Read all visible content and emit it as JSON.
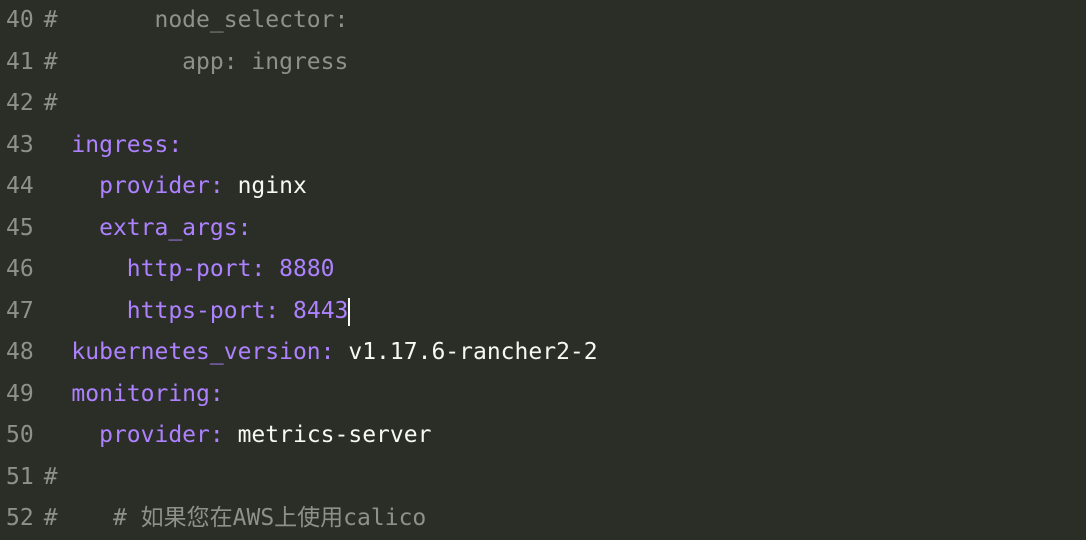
{
  "lines": [
    {
      "num": "40",
      "tokens": [
        {
          "text": "#       node_selector:",
          "cls": "comment"
        }
      ]
    },
    {
      "num": "41",
      "tokens": [
        {
          "text": "#         app: ingress",
          "cls": "comment"
        }
      ]
    },
    {
      "num": "42",
      "tokens": [
        {
          "text": "#",
          "cls": "comment"
        }
      ]
    },
    {
      "num": "43",
      "tokens": [
        {
          "text": "  ",
          "cls": ""
        },
        {
          "text": "ingress",
          "cls": "key"
        },
        {
          "text": ":",
          "cls": "colon"
        }
      ]
    },
    {
      "num": "44",
      "tokens": [
        {
          "text": "    ",
          "cls": ""
        },
        {
          "text": "provider",
          "cls": "key"
        },
        {
          "text": ":",
          "cls": "colon"
        },
        {
          "text": " nginx",
          "cls": "string"
        }
      ]
    },
    {
      "num": "45",
      "tokens": [
        {
          "text": "    ",
          "cls": ""
        },
        {
          "text": "extra_args",
          "cls": "key"
        },
        {
          "text": ":",
          "cls": "colon"
        }
      ]
    },
    {
      "num": "46",
      "tokens": [
        {
          "text": "      ",
          "cls": ""
        },
        {
          "text": "http-port",
          "cls": "key"
        },
        {
          "text": ":",
          "cls": "colon"
        },
        {
          "text": " ",
          "cls": ""
        },
        {
          "text": "8880",
          "cls": "number"
        }
      ]
    },
    {
      "num": "47",
      "tokens": [
        {
          "text": "      ",
          "cls": ""
        },
        {
          "text": "https-port",
          "cls": "key"
        },
        {
          "text": ":",
          "cls": "colon"
        },
        {
          "text": " ",
          "cls": ""
        },
        {
          "text": "8443",
          "cls": "number"
        }
      ],
      "cursorAfter": true
    },
    {
      "num": "48",
      "tokens": [
        {
          "text": "  ",
          "cls": ""
        },
        {
          "text": "kubernetes_version",
          "cls": "key"
        },
        {
          "text": ":",
          "cls": "colon"
        },
        {
          "text": " v1.17.6-rancher2-2",
          "cls": "string"
        }
      ]
    },
    {
      "num": "49",
      "tokens": [
        {
          "text": "  ",
          "cls": ""
        },
        {
          "text": "monitoring",
          "cls": "key"
        },
        {
          "text": ":",
          "cls": "colon"
        }
      ]
    },
    {
      "num": "50",
      "tokens": [
        {
          "text": "    ",
          "cls": ""
        },
        {
          "text": "provider",
          "cls": "key"
        },
        {
          "text": ":",
          "cls": "colon"
        },
        {
          "text": " metrics-server",
          "cls": "string"
        }
      ]
    },
    {
      "num": "51",
      "tokens": [
        {
          "text": "#",
          "cls": "comment"
        }
      ]
    },
    {
      "num": "52",
      "tokens": [
        {
          "text": "#    # 如果您在AWS上使用calico",
          "cls": "comment"
        }
      ]
    }
  ]
}
